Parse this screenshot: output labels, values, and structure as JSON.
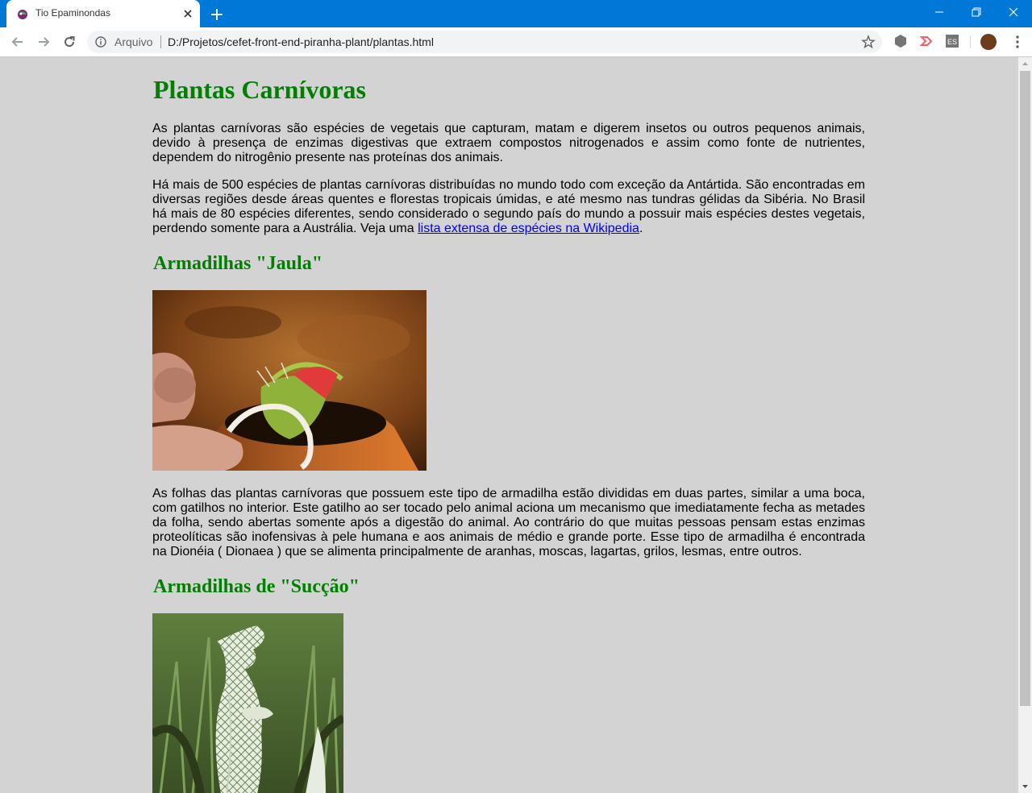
{
  "browser": {
    "tab_title": "Tio Epaminondas",
    "scheme_label": "Arquivo",
    "url": "D:/Projetos/cefet-front-end-piranha-plant/plantas.html",
    "accent_color": "#0078d7"
  },
  "page": {
    "title": "Plantas Carnívoras",
    "intro": "As plantas carnívoras são espécies de vegetais que capturam, matam e digerem insetos ou outros pequenos animais, devido à presença de enzimas digestivas que extraem compostos nitrogenados e assim como fonte de nutrientes, dependem do nitrogênio presente nas proteínas dos animais.",
    "paragraph2_before_link": "Há mais de 500 espécies de plantas carnívoras distribuídas no mundo todo com exceção da Antártida. São encontradas em diversas regiões desde áreas quentes e florestas tropicais úmidas, e até mesmo nas tundras gélidas da Sibéria. No Brasil há mais de 80 espécies diferentes, sendo considerado o segundo país do mundo a possuir mais espécies destes vegetais, perdendo somente para a Austrália. Veja uma ",
    "paragraph2_link": "lista extensa de espécies na Wikipedia",
    "paragraph2_after_link": ".",
    "section_jaula": {
      "heading": "Armadilhas \"Jaula\"",
      "text": "As folhas das plantas carnívoras que possuem este tipo de armadilha estão divididas em duas partes, similar a uma boca, com gatilhos no interior. Este gatilho ao ser tocado pelo animal aciona um mecanismo que imediatamente fecha as metades da folha, sendo abertas somente após a digestão do animal. Ao contrário do que muitas pessoas pensam estas enzimas proteolíticas são inofensivas à pele humana e aos animais de médio e grande porte. Esse tipo de armadilha é encontrada na Dionéia ( Dionaea ) que se alimenta principalmente de aranhas, moscas, lagartas, grilos, lesmas, entre outros."
    },
    "section_succao": {
      "heading": "Armadilhas de \"Sucção\""
    },
    "colors": {
      "background": "#d3d3d3",
      "heading": "#008000",
      "link": "#0000ee"
    }
  }
}
